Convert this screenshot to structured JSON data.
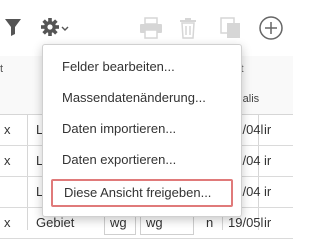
{
  "toolbar": {
    "icons": [
      "filter-icon",
      "gear-icon",
      "printer-icon",
      "trash-icon",
      "copy-icon",
      "add-icon"
    ],
    "caret": "⌄"
  },
  "grid": {
    "header_left": "t",
    "header_right": "eit",
    "header2_right": "ktualis",
    "rows": [
      {
        "a": "x",
        "b": "L",
        "c": "19/04l",
        "d": "ir"
      },
      {
        "a": "x",
        "b": "L",
        "c": "19/04",
        "d": "ir"
      },
      {
        "a": "",
        "b": "L",
        "c": "19/04",
        "d": "ir"
      },
      {
        "a": "x",
        "b": "Gebiet",
        "c1": "wg",
        "c2": "wg",
        "n": "n",
        "c": "19/05l",
        "d": "ir"
      }
    ]
  },
  "menu": {
    "items": [
      "Felder bearbeiten...",
      "Massendatenänderung...",
      "Daten importieren...",
      "Daten exportieren...",
      "Diese Ansicht freigeben..."
    ],
    "active_index": 4,
    "highlight_color": "#e07a7a"
  }
}
